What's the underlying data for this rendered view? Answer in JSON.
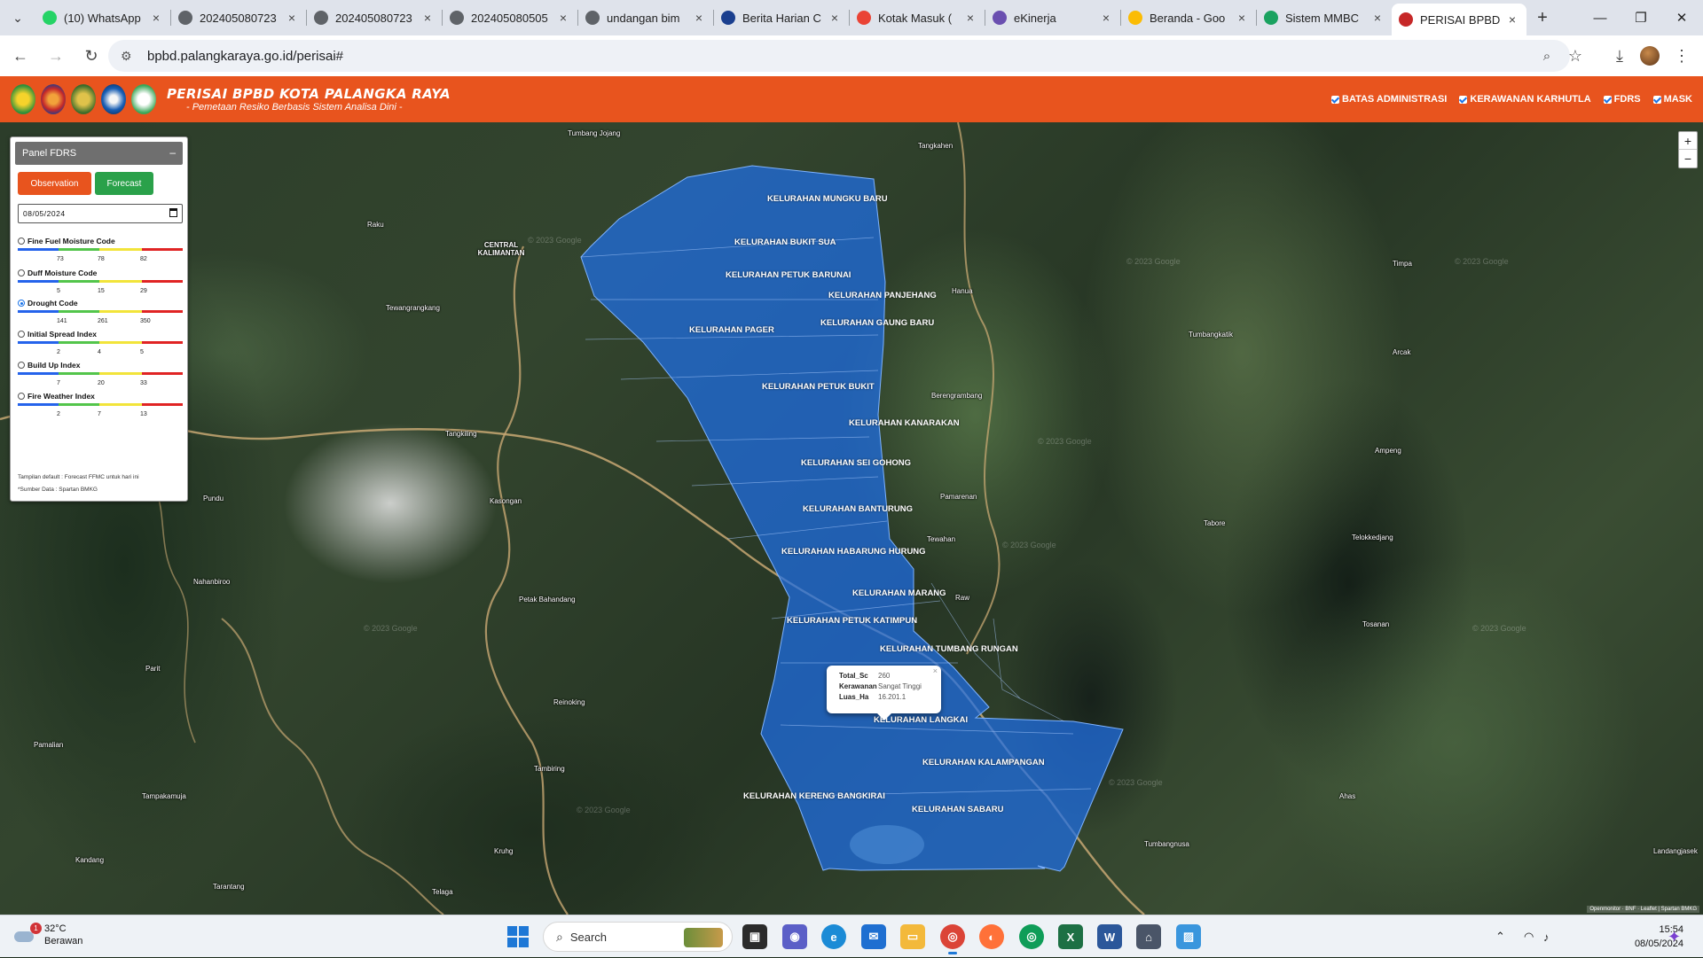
{
  "browser": {
    "tabs": [
      {
        "title": "(10) WhatsApp",
        "icon": "whatsapp-icon",
        "color": "#25d366"
      },
      {
        "title": "202405080723",
        "icon": "globe-icon",
        "color": "#5f6368"
      },
      {
        "title": "202405080723",
        "icon": "globe-icon",
        "color": "#5f6368"
      },
      {
        "title": "202405080505",
        "icon": "globe-icon",
        "color": "#5f6368"
      },
      {
        "title": "undangan bim",
        "icon": "globe-icon",
        "color": "#5f6368"
      },
      {
        "title": "Berita Harian C",
        "icon": "play-icon",
        "color": "#1a3f8f"
      },
      {
        "title": "Kotak Masuk (",
        "icon": "gmail-icon",
        "color": "#ea4335"
      },
      {
        "title": "eKinerja",
        "icon": "dots-icon",
        "color": "#6a4fb0"
      },
      {
        "title": "Beranda - Goo",
        "icon": "drive-icon",
        "color": "#fbbc04"
      },
      {
        "title": "Sistem MMBC",
        "icon": "app-icon",
        "color": "#1aa260"
      },
      {
        "title": "PERISAI BPBD",
        "icon": "perisai-icon",
        "color": "#c62828"
      }
    ],
    "url": "bpbd.palangkaraya.go.id/perisai#"
  },
  "header": {
    "title": "PERISAI BPBD KOTA PALANGKA RAYA",
    "subtitle": "- Pemetaan Resiko Berbasis Sistem Analisa Dini -",
    "toggles": [
      "BATAS ADMINISTRASI",
      "KERAWANAN KARHUTLA",
      "FDRS",
      "MASK"
    ]
  },
  "panel": {
    "title": "Panel FDRS",
    "observation_label": "Observation",
    "forecast_label": "Forecast",
    "date": "08/05/2024",
    "indices": [
      {
        "label": "Fine Fuel Moisture Code",
        "ticks": [
          "73",
          "78",
          "82"
        ],
        "selected": false
      },
      {
        "label": "Duff Moisture Code",
        "ticks": [
          "5",
          "15",
          "29"
        ],
        "selected": false
      },
      {
        "label": "Drought Code",
        "ticks": [
          "141",
          "261",
          "350"
        ],
        "selected": true
      },
      {
        "label": "Initial Spread Index",
        "ticks": [
          "2",
          "4",
          "5"
        ],
        "selected": false
      },
      {
        "label": "Build Up Index",
        "ticks": [
          "7",
          "20",
          "33"
        ],
        "selected": false
      },
      {
        "label": "Fire Weather Index",
        "ticks": [
          "2",
          "7",
          "13"
        ],
        "selected": false
      }
    ],
    "note1": "Tampilan default : Forecast FFMC untuk hari ini",
    "note2": "*Sumber Data : Spartan BMKG"
  },
  "map": {
    "kelurahan": [
      "KELURAHAN MUNGKU BARU",
      "KELURAHAN BUKIT SUA",
      "KELURAHAN PETUK BARUNAI",
      "KELURAHAN PANJEHANG",
      "KELURAHAN GAUNG BARU",
      "KELURAHAN PAGER",
      "KELURAHAN PETUK BUKIT",
      "KELURAHAN KANARAKAN",
      "KELURAHAN SEI GOHONG",
      "KELURAHAN BANTURUNG",
      "KELURAHAN HABARUNG HURUNG",
      "KELURAHAN MARANG",
      "KELURAHAN PETUK KATIMPUN",
      "KELURAHAN TUMBANG RUNGAN",
      "KELURAHAN LANGKAI",
      "KELURAHAN KALAMPANGAN",
      "KELURAHAN KERENG BANGKIRAI",
      "KELURAHAN SABARU"
    ],
    "places": [
      "Tumbang Jojang",
      "Tangkahen",
      "Raku",
      "CENTRAL KALIMANTAN",
      "Tewangrangkang",
      "Hanua",
      "Timpa",
      "Arcak",
      "Berengrambang",
      "Tumbangkatik",
      "Tangkiling",
      "Ampeng",
      "Pundu",
      "Kasongan",
      "Pamarenan",
      "Tabore",
      "Tewahan",
      "Telokkedjang",
      "Nahanbiroo",
      "Petak Bahandang",
      "Raw",
      "Tosanan",
      "Parit",
      "Pamalian",
      "Reinoking",
      "Tampakamuja",
      "Tambiring",
      "Kandang",
      "Tarantang",
      "Kruhg",
      "Telaga",
      "Tumbangnusa",
      "Ahas",
      "Landangjasek"
    ],
    "popup": {
      "rows": [
        {
          "key": "Total_Sc",
          "value": "260"
        },
        {
          "key": "Kerawanan",
          "value": "Sangat Tinggi"
        },
        {
          "key": "Luas_Ha",
          "value": "16.201.1"
        }
      ]
    },
    "watermark": "© 2023 Google",
    "attribution": "Openmonitor · BNF · Leaflet | Spartan BMKG",
    "zoom_in": "+",
    "zoom_out": "−"
  },
  "taskbar": {
    "weather_temp": "32°C",
    "weather_desc": "Berawan",
    "weather_badge": "1",
    "search_label": "Search",
    "time": "15:54",
    "date": "08/05/2024"
  },
  "colors": {
    "header": "#e8541e",
    "forecast": "#2aa14a",
    "region_fill": "#1f6fe8"
  }
}
